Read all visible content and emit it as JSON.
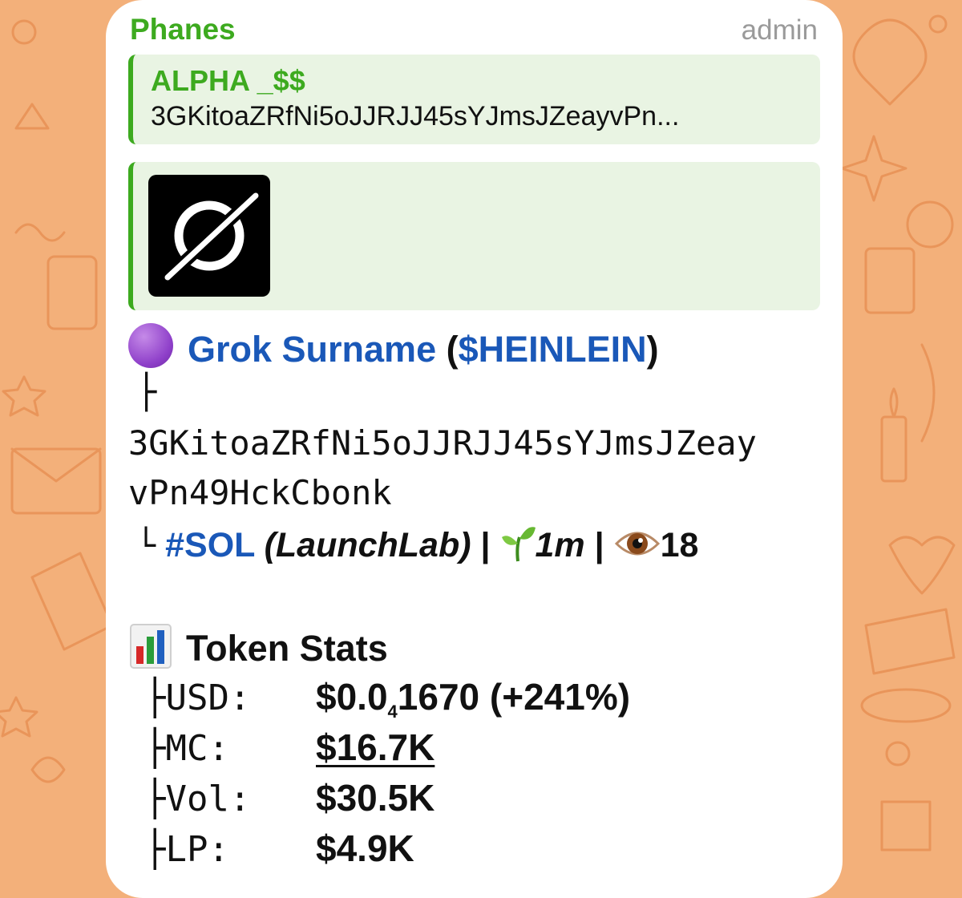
{
  "message": {
    "sender": "Phanes",
    "role": "admin",
    "reply": {
      "name": "ALPHA _$$",
      "text": "3GKitoaZRfNi5oJJRJJ45sYJmsJZeayvPn..."
    },
    "token": {
      "emoji": "purple-circle",
      "name": "Grok Surname",
      "open_paren": " (",
      "ticker": "$HEINLEIN",
      "close_paren": ")"
    },
    "branch_symbol": "├",
    "address_line1": "3GKitoaZRfNi5oJJRJJ45sYJmsJZeay",
    "address_line2": "vPn49HckCbonk",
    "meta": {
      "corner_symbol": "└",
      "chain": "#SOL",
      "platform": "(LaunchLab)",
      "separator": " | ",
      "age": "1m",
      "views": "18"
    },
    "stats_title": "Token Stats",
    "stats": [
      {
        "label": "├USD:",
        "value": "$0.0",
        "sub": "4",
        "value_rest": "1670",
        "change": " (+241%)"
      },
      {
        "label": "├MC:",
        "value": "$16.7K"
      },
      {
        "label": "├Vol:",
        "value": "$30.5K"
      },
      {
        "label": "├LP:",
        "value": "$4.9K"
      }
    ]
  },
  "colors": {
    "background": "#f3b07a",
    "doodle": "#e9955a",
    "sender": "#3daa1f",
    "link": "#1a58b8",
    "quote_bg": "#e9f4e3"
  }
}
